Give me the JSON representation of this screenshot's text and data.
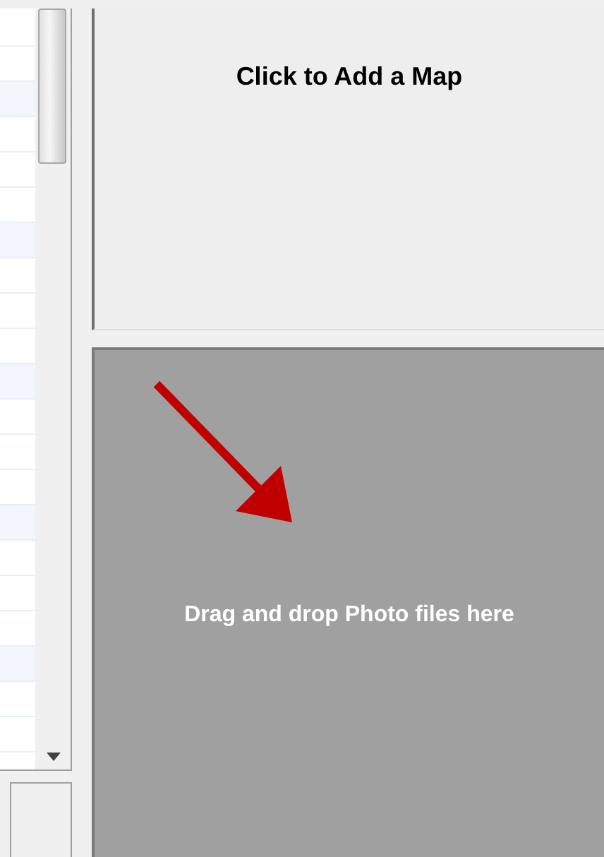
{
  "map_panel": {
    "label": "Click to Add a Map"
  },
  "drop_zone": {
    "label": "Drag and drop Photo files here"
  }
}
